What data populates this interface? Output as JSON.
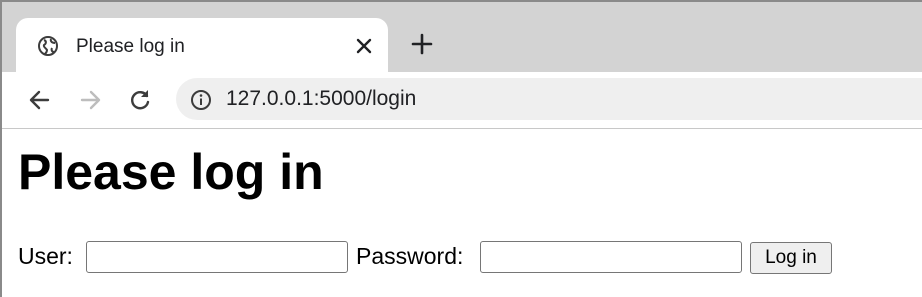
{
  "browser": {
    "tab": {
      "title": "Please log in",
      "favicon": "globe-icon",
      "close_icon": "close-icon"
    },
    "new_tab_icon": "plus-icon",
    "toolbar": {
      "back_icon": "arrow-left-icon",
      "forward_icon": "arrow-right-icon",
      "reload_icon": "reload-icon",
      "site_info_icon": "info-icon",
      "url": "127.0.0.1:5000/login"
    }
  },
  "page": {
    "heading": "Please log in",
    "form": {
      "user_label": "User:",
      "user_value": "",
      "password_label": "Password:",
      "password_value": "",
      "submit_label": "Log in"
    }
  },
  "colors": {
    "tabstrip_bg": "#d3d3d3",
    "omnibox_bg": "#efefef",
    "forward_disabled": "#bdbdbd"
  }
}
